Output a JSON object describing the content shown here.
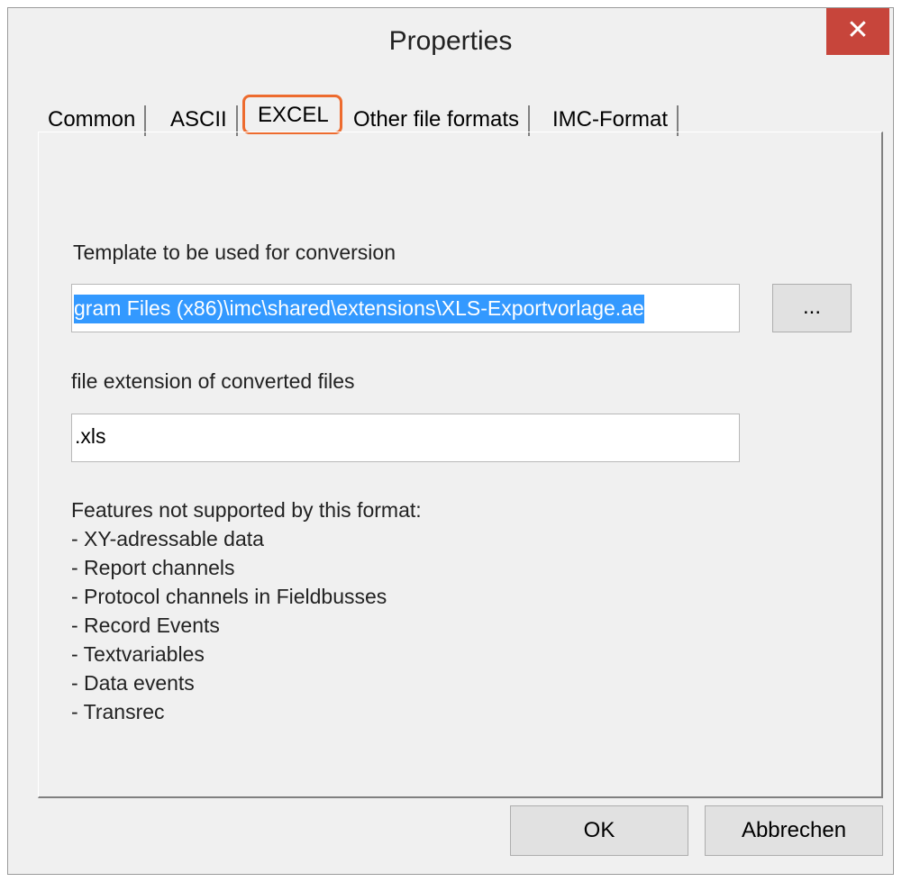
{
  "window": {
    "title": "Properties",
    "close_icon": "✕"
  },
  "tabs": [
    {
      "label": "Common"
    },
    {
      "label": "ASCII"
    },
    {
      "label": "EXCEL",
      "active": true
    },
    {
      "label": "Other file formats"
    },
    {
      "label": "IMC-Format"
    }
  ],
  "excel": {
    "template_label": "Template to be used for conversion",
    "template_value": "gram Files (x86)\\imc\\shared\\extensions\\XLS-Exportvorlage.ae",
    "browse_label": "...",
    "extension_label": "file extension of converted files",
    "extension_value": ".xls",
    "features": [
      "Features not supported by this format:",
      "- XY-adressable data",
      "- Report channels",
      "- Protocol channels in Fieldbusses",
      "- Record Events",
      "- Textvariables",
      "- Data events",
      "- Transrec"
    ]
  },
  "buttons": {
    "ok": "OK",
    "cancel": "Abbrechen"
  },
  "colors": {
    "highlight": "#ed6b2e",
    "selection": "#3399ff",
    "close_button": "#c7453b"
  }
}
